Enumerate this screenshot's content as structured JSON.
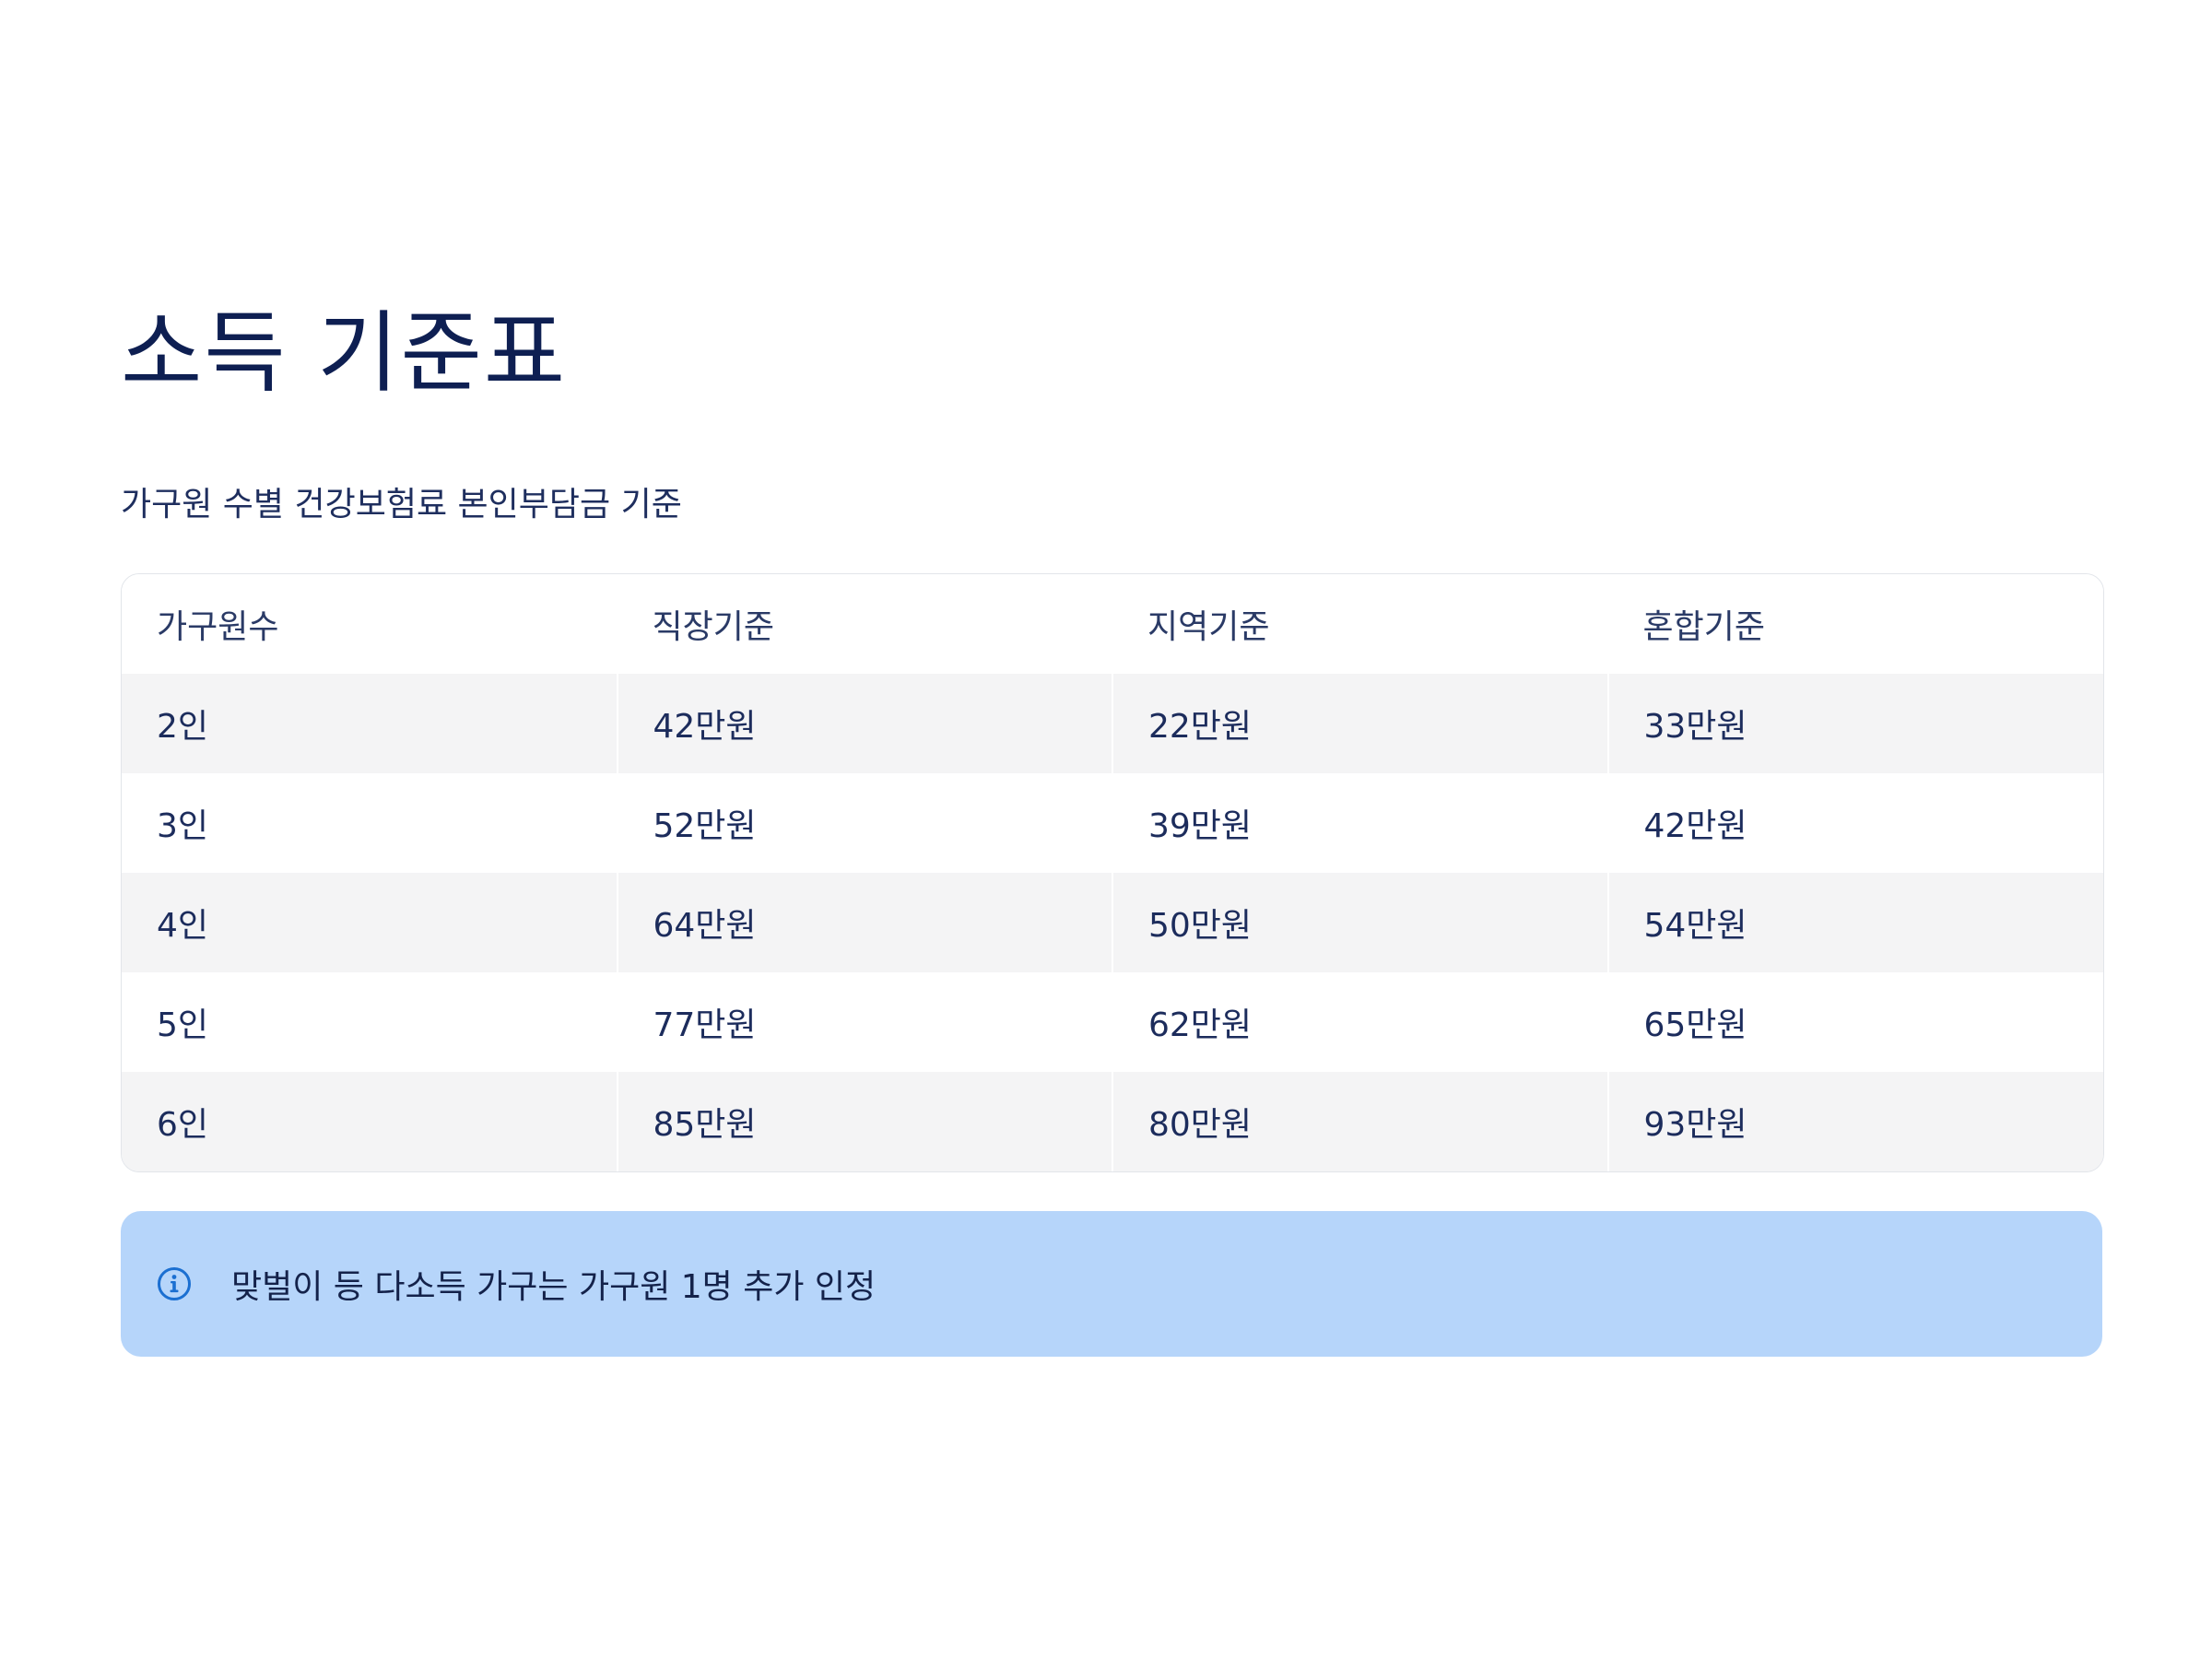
{
  "page": {
    "title": "소득 기준표",
    "subtitle": "가구원 수별 건강보험료 본인부담금 기준"
  },
  "table": {
    "headers": [
      "가구원수",
      "직장기준",
      "지역기준",
      "혼합기준"
    ],
    "rows": [
      [
        "2인",
        "42만원",
        "22만원",
        "33만원"
      ],
      [
        "3인",
        "52만원",
        "39만원",
        "42만원"
      ],
      [
        "4인",
        "64만원",
        "50만원",
        "54만원"
      ],
      [
        "5인",
        "77만원",
        "62만원",
        "65만원"
      ],
      [
        "6인",
        "85만원",
        "80만원",
        "93만원"
      ]
    ]
  },
  "notice": {
    "icon": "info-icon",
    "text": "맞벌이 등 다소득 가구는 가구원 1명 추가 인정"
  },
  "colors": {
    "title": "#0e1f52",
    "text": "#1c2c5c",
    "row_stripe": "#f4f4f5",
    "notice_bg": "#b6d5fa",
    "icon": "#1b6fd1"
  }
}
